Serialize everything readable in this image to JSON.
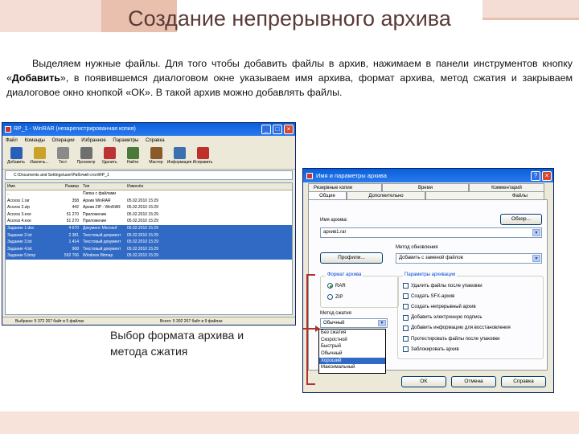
{
  "slide": {
    "title": "Создание непрерывного архива",
    "paragraph_start": "Выделяем нужные файлы. Для того чтобы добавить файлы в архив, нажимаем в панели инструментов кнопку «",
    "paragraph_bold": "Добавить",
    "paragraph_end": "», в появившемся диалоговом окне указываем имя архива, формат архива, метод сжатия и закрываем диалоговое окно кнопкой «ОК». В такой архив можно добавлять файлы.",
    "caption_line1": "Выбор формата архива и",
    "caption_line2": "метода сжатия"
  },
  "winrar": {
    "title": "RP_1 - WinRAR (незарегистрированная копия)",
    "menu": [
      "Файл",
      "Команды",
      "Операции",
      "Избранное",
      "Параметры",
      "Справка"
    ],
    "toolbar": [
      {
        "label": "Добавить",
        "icon": "add-archive-icon",
        "color": "#2a5fb8"
      },
      {
        "label": "Извлечь...",
        "icon": "extract-icon",
        "color": "#c9a227"
      },
      {
        "label": "Тест",
        "icon": "test-icon",
        "color": "#8a8a8a"
      },
      {
        "label": "Просмотр",
        "icon": "view-icon",
        "color": "#6f6f6f"
      },
      {
        "label": "Удалить",
        "icon": "delete-icon",
        "color": "#b33"
      },
      {
        "label": "Найти",
        "icon": "find-icon",
        "color": "#4a7a3a"
      },
      {
        "label": "Мастер",
        "icon": "wizard-icon",
        "color": "#8b5a2b"
      },
      {
        "label": "Информация",
        "icon": "info-icon",
        "color": "#3a6fb0"
      },
      {
        "label": "Исправить",
        "icon": "repair-icon",
        "color": "#c0302a"
      }
    ],
    "address": "C:\\Documents and Settings\\user\\Рабочий стол\\RP_1",
    "columns": [
      "Имя",
      "Размер",
      "Тип",
      "Изменён"
    ],
    "files": [
      {
        "name": "..",
        "size": "",
        "type": "Папка с файлами",
        "date": "",
        "selected": false
      },
      {
        "name": "Access 1.rar",
        "size": "358",
        "type": "Архив WinRAR",
        "date": "05.02.2010 15:29",
        "selected": false
      },
      {
        "name": "Access 2.zip",
        "size": "442",
        "type": "Архив ZIP - WinRAR",
        "date": "05.02.2010 15:29",
        "selected": false
      },
      {
        "name": "Access 3.exe",
        "size": "51 270",
        "type": "Приложение",
        "date": "05.02.2010 15:29",
        "selected": false
      },
      {
        "name": "Access 4.exe",
        "size": "51 270",
        "type": "Приложение",
        "date": "05.02.2010 15:29",
        "selected": false
      },
      {
        "name": "Задание 1.doc",
        "size": "4 670",
        "type": "Документ Microsof",
        "date": "05.02.2010 15:29",
        "selected": true
      },
      {
        "name": "Задание 2.txt",
        "size": "2 381",
        "type": "Текстовый документ",
        "date": "05.02.2010 15:29",
        "selected": true
      },
      {
        "name": "Задание 3.txt",
        "size": "1 414",
        "type": "Текстовый документ",
        "date": "05.02.2010 15:29",
        "selected": true
      },
      {
        "name": "Задание 4.txt",
        "size": "968",
        "type": "Текстовый документ",
        "date": "05.02.2010 15:29",
        "selected": true
      },
      {
        "name": "Задание 5.bmp",
        "size": "552 706",
        "type": "Windows Bitmap",
        "date": "05.02.2010 15:29",
        "selected": true
      }
    ],
    "status_left": "Выбрано: 5 372 267 байт в 5 файлах",
    "status_right": "Всего: 5 392 267 байт в 9 файлах"
  },
  "dialog": {
    "title": "Имя и параметры архива",
    "tabs_back": [
      "Резервные копии",
      "Время",
      "Комментарий"
    ],
    "tabs_front": [
      "Общие",
      "Дополнительно",
      "Файлы"
    ],
    "archive_name_label": "Имя архива:",
    "archive_name_value": "архив1.rar",
    "browse_button": "Обзор...",
    "profiles_button": "Профили...",
    "update_method_label": "Метод обновления",
    "update_method_value": "Добавить с заменой файлов",
    "format_group_title": "Формат архива",
    "format_options": [
      {
        "label": "RAR",
        "selected": true
      },
      {
        "label": "ZIP",
        "selected": false
      }
    ],
    "method_label": "Метод сжатия",
    "method_value": "Обычный",
    "method_options": [
      "Без сжатия",
      "Скоростной",
      "Быстрый",
      "Обычный",
      "Хороший",
      "Максимальный"
    ],
    "method_selected_index": 4,
    "params_group_title": "Параметры архивации",
    "params": [
      "Удалить файлы после упаковки",
      "Создать SFX-архив",
      "Создать непрерывный архив",
      "Добавить электронную подпись",
      "Добавить информацию для восстановления",
      "Протестировать файлы после упаковки",
      "Заблокировать архив"
    ],
    "ok_button": "OK",
    "cancel_button": "Отмена",
    "help_button": "Справка"
  },
  "colors": {
    "title_text": "#5a3a36",
    "annotation_red": "#b0312a",
    "selection": "#316ac5"
  }
}
